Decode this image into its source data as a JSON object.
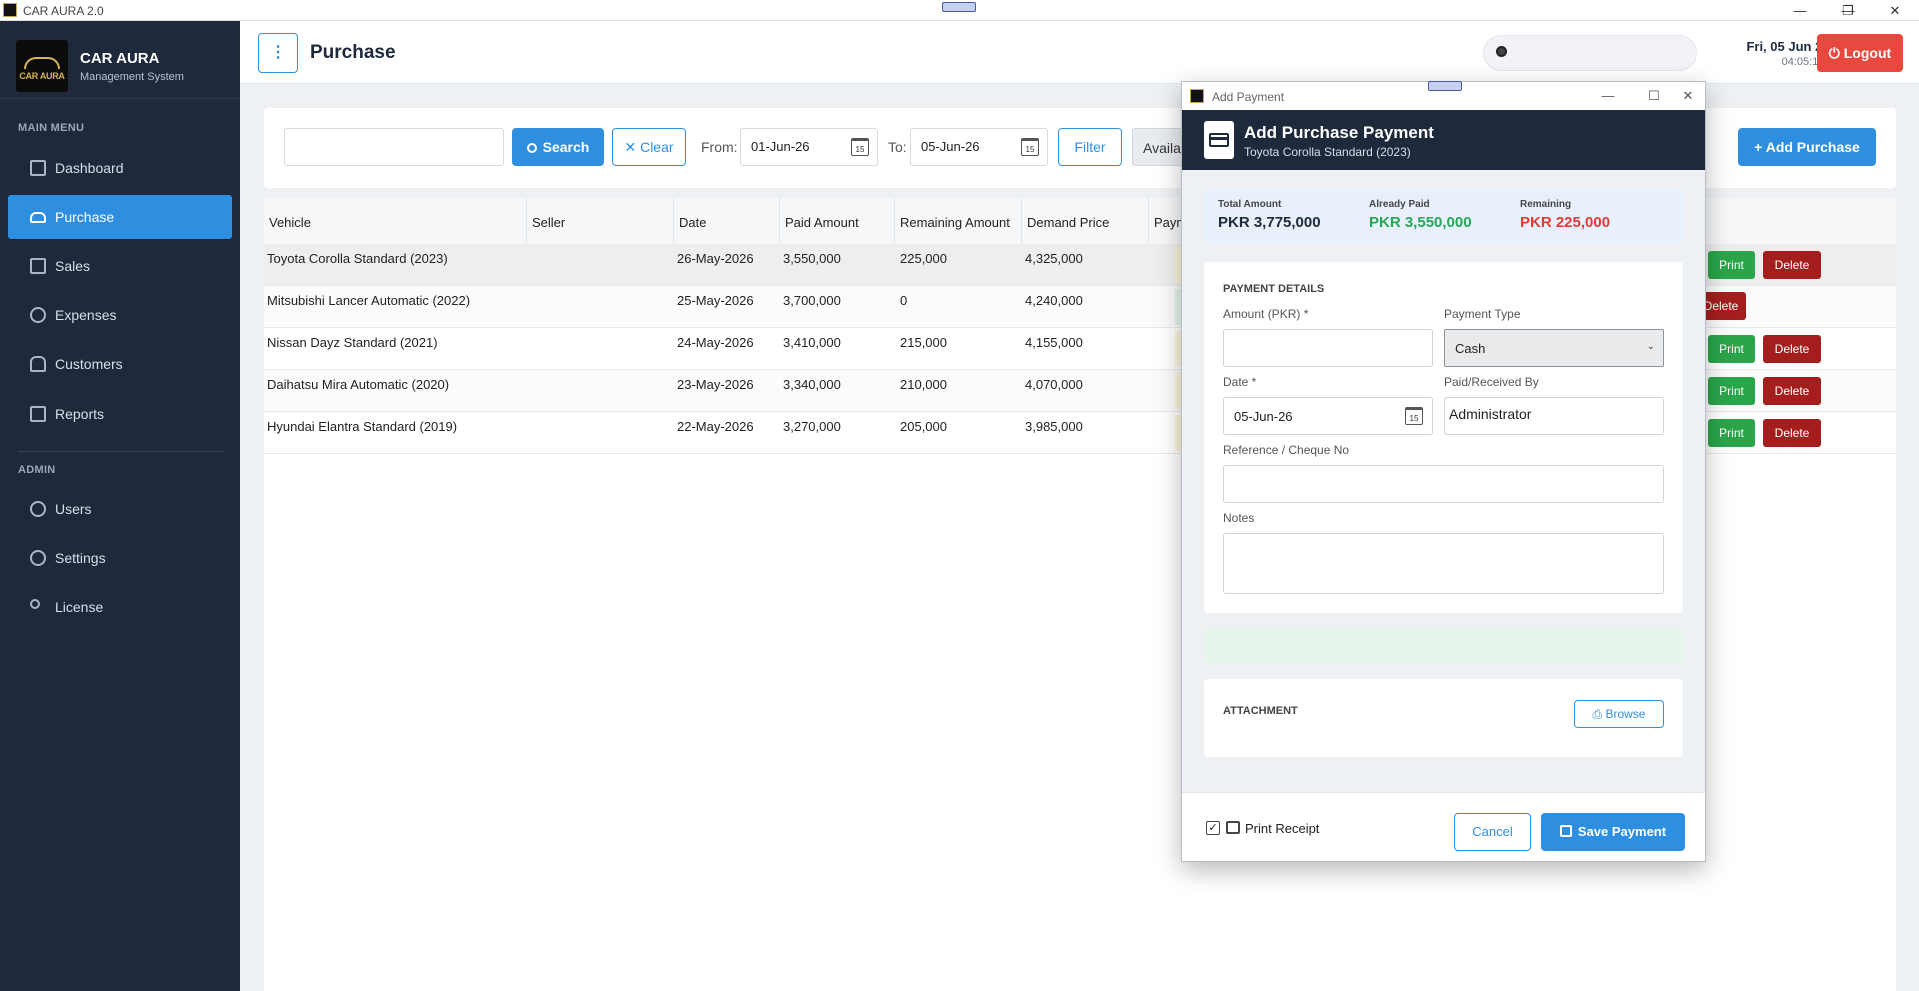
{
  "window": {
    "title": "CAR AURA 2.0",
    "minimize": "—",
    "restore": "❐",
    "close": "✕"
  },
  "brand": {
    "logo_text": "CAR AURA",
    "name": "CAR AURA",
    "subtitle": "Management System"
  },
  "sidebar": {
    "main_menu_heading": "MAIN MENU",
    "admin_heading": "ADMIN",
    "main_items": [
      {
        "label": "Dashboard",
        "icon": "dashboard-icon",
        "active": false
      },
      {
        "label": "Purchase",
        "icon": "car-icon",
        "active": true
      },
      {
        "label": "Sales",
        "icon": "sales-icon",
        "active": false
      },
      {
        "label": "Expenses",
        "icon": "gear-icon",
        "active": false
      },
      {
        "label": "Customers",
        "icon": "users-icon",
        "active": false
      },
      {
        "label": "Reports",
        "icon": "report-icon",
        "active": false
      }
    ],
    "admin_items": [
      {
        "label": "Users",
        "icon": "user-icon"
      },
      {
        "label": "Settings",
        "icon": "settings-icon"
      },
      {
        "label": "License",
        "icon": "key-icon"
      }
    ]
  },
  "topbar": {
    "menu_glyph": "⋮",
    "page_title": "Purchase",
    "search_placeholder": "",
    "date": "Fri, 05 Jun 2026",
    "time": "04:05:10 PM",
    "logout_label": "⏻ Logout"
  },
  "toolbar": {
    "search_value": "",
    "search_label": "Search",
    "clear_label": "Clear",
    "from_label": "From:",
    "from_date": "01-Jun-26",
    "to_label": "To:",
    "to_date": "05-Jun-26",
    "filter_label": "Filter",
    "available_label": "Availab",
    "add_purchase_label": "Add Purchase",
    "calendar_glyph": "15"
  },
  "table": {
    "columns": [
      "Vehicle",
      "Seller",
      "Date",
      "Paid Amount",
      "Remaining Amount",
      "Demand Price",
      "Paym"
    ],
    "rows": [
      {
        "vehicle": "Toyota Corolla Standard (2023)",
        "seller": "",
        "date": "26-May-2026",
        "paid": "3,550,000",
        "remaining": "225,000",
        "demand": "4,325,000",
        "actions": [
          "Print",
          "Delete"
        ]
      },
      {
        "vehicle": "Mitsubishi Lancer Automatic (2022)",
        "seller": "",
        "date": "25-May-2026",
        "paid": "3,700,000",
        "remaining": "0",
        "demand": "4,240,000",
        "actions": [
          "Delete"
        ]
      },
      {
        "vehicle": "Nissan Dayz Standard (2021)",
        "seller": "",
        "date": "24-May-2026",
        "paid": "3,410,000",
        "remaining": "215,000",
        "demand": "4,155,000",
        "actions": [
          "Print",
          "Delete"
        ]
      },
      {
        "vehicle": "Daihatsu Mira Automatic (2020)",
        "seller": "",
        "date": "23-May-2026",
        "paid": "3,340,000",
        "remaining": "210,000",
        "demand": "4,070,000",
        "actions": [
          "Print",
          "Delete"
        ]
      },
      {
        "vehicle": "Hyundai Elantra Standard (2019)",
        "seller": "",
        "date": "22-May-2026",
        "paid": "3,270,000",
        "remaining": "205,000",
        "demand": "3,985,000",
        "actions": [
          "Print",
          "Delete"
        ]
      }
    ]
  },
  "modal": {
    "window_title": "Add Payment",
    "title": "Add Purchase Payment",
    "subtitle": "Toyota Corolla Standard (2023)",
    "summary": {
      "total_label": "Total Amount",
      "total_value": "PKR 3,775,000",
      "paid_label": "Already Paid",
      "paid_value": "PKR 3,550,000",
      "remaining_label": "Remaining",
      "remaining_value": "PKR 225,000"
    },
    "details_heading": "PAYMENT DETAILS",
    "amount_label": "Amount (PKR) *",
    "amount_value": "",
    "payment_type_label": "Payment Type",
    "payment_type_value": "Cash",
    "date_label": "Date *",
    "date_value": "05-Jun-26",
    "received_by_label": "Paid/Received By",
    "received_by_value": "Administrator",
    "reference_label": "Reference / Cheque No",
    "reference_value": "",
    "notes_label": "Notes",
    "notes_value": "",
    "attachment_heading": "ATTACHMENT",
    "browse_label": "Browse",
    "print_receipt_label": "Print Receipt",
    "print_receipt_checked": "✓",
    "cancel_label": "Cancel",
    "save_label": "Save Payment"
  },
  "colors": {
    "sidebar_bg": "#1e2a3b",
    "accent": "#2e8fe0",
    "danger": "#e8483d",
    "delete": "#a51e1e",
    "success": "#2aa54a",
    "paid_green": "#27a658",
    "remaining_red": "#e53935"
  }
}
